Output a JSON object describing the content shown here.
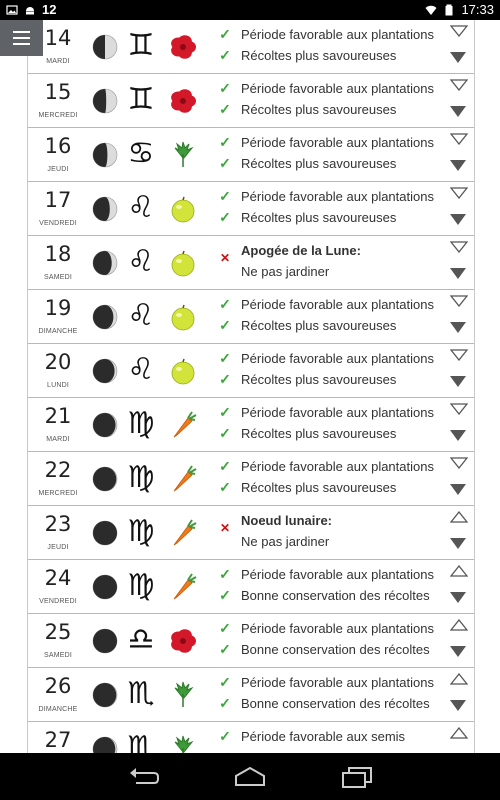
{
  "status_bar": {
    "time": "17:33",
    "notification_count": "12",
    "icons": [
      "image-icon",
      "android-icon",
      "wifi-icon",
      "battery-icon"
    ]
  },
  "colors": {
    "check": "#3aa63a",
    "cross": "#d01010",
    "menu_bg": "#5f6368"
  },
  "rows": [
    {
      "day": "14",
      "weekday": "MARDI",
      "moon": 0.5,
      "zodiac": "♊",
      "plant": "flower",
      "mark1": "check",
      "line1": "Période favorable aux plantations",
      "bold1": false,
      "mark2": "check",
      "line2": "Récoltes plus savoureuses",
      "arrow": "down"
    },
    {
      "day": "15",
      "weekday": "MERCREDI",
      "moon": 0.55,
      "zodiac": "♊",
      "plant": "flower",
      "mark1": "check",
      "line1": "Période favorable aux plantations",
      "bold1": false,
      "mark2": "check",
      "line2": "Récoltes plus savoureuses",
      "arrow": "down"
    },
    {
      "day": "16",
      "weekday": "JEUDI",
      "moon": 0.6,
      "zodiac": "♋",
      "plant": "leaf",
      "mark1": "check",
      "line1": "Période favorable aux plantations",
      "bold1": false,
      "mark2": "check",
      "line2": "Récoltes plus savoureuses",
      "arrow": "down"
    },
    {
      "day": "17",
      "weekday": "VENDREDI",
      "moon": 0.7,
      "zodiac": "♌",
      "plant": "fruit",
      "mark1": "check",
      "line1": "Période favorable aux plantations",
      "bold1": false,
      "mark2": "check",
      "line2": "Récoltes plus savoureuses",
      "arrow": "down"
    },
    {
      "day": "18",
      "weekday": "SAMEDI",
      "moon": 0.78,
      "zodiac": "♌",
      "plant": "fruit",
      "mark1": "cross",
      "line1": "Apogée de la Lune:",
      "bold1": true,
      "mark2": "",
      "line2": "Ne pas jardiner",
      "arrow": "down"
    },
    {
      "day": "19",
      "weekday": "DIMANCHE",
      "moon": 0.85,
      "zodiac": "♌",
      "plant": "fruit",
      "mark1": "check",
      "line1": "Période favorable aux plantations",
      "bold1": false,
      "mark2": "check",
      "line2": "Récoltes plus savoureuses",
      "arrow": "down"
    },
    {
      "day": "20",
      "weekday": "LUNDI",
      "moon": 0.9,
      "zodiac": "♌",
      "plant": "fruit",
      "mark1": "check",
      "line1": "Période favorable aux plantations",
      "bold1": false,
      "mark2": "check",
      "line2": "Récoltes plus savoureuses",
      "arrow": "down"
    },
    {
      "day": "21",
      "weekday": "MARDI",
      "moon": 0.94,
      "zodiac": "♍",
      "plant": "root",
      "mark1": "check",
      "line1": "Période favorable aux plantations",
      "bold1": false,
      "mark2": "check",
      "line2": "Récoltes plus savoureuses",
      "arrow": "down"
    },
    {
      "day": "22",
      "weekday": "MERCREDI",
      "moon": 0.97,
      "zodiac": "♍",
      "plant": "root",
      "mark1": "check",
      "line1": "Période favorable aux plantations",
      "bold1": false,
      "mark2": "check",
      "line2": "Récoltes plus savoureuses",
      "arrow": "down"
    },
    {
      "day": "23",
      "weekday": "JEUDI",
      "moon": 1.0,
      "zodiac": "♍",
      "plant": "root",
      "mark1": "cross",
      "line1": "Noeud lunaire:",
      "bold1": true,
      "mark2": "",
      "line2": "Ne pas jardiner",
      "arrow": "up"
    },
    {
      "day": "24",
      "weekday": "VENDREDI",
      "moon": 1.0,
      "zodiac": "♍",
      "plant": "root",
      "mark1": "check",
      "line1": "Période favorable aux plantations",
      "bold1": false,
      "mark2": "check",
      "line2": "Bonne conservation des récoltes",
      "arrow": "up"
    },
    {
      "day": "25",
      "weekday": "SAMEDI",
      "moon": 1.0,
      "zodiac": "♎",
      "plant": "flower",
      "mark1": "check",
      "line1": "Période favorable aux plantations",
      "bold1": false,
      "mark2": "check",
      "line2": "Bonne conservation des récoltes",
      "arrow": "up"
    },
    {
      "day": "26",
      "weekday": "DIMANCHE",
      "moon": 0.97,
      "zodiac": "♏",
      "plant": "leaf",
      "mark1": "check",
      "line1": "Période favorable aux plantations",
      "bold1": false,
      "mark2": "check",
      "line2": "Bonne conservation des récoltes",
      "arrow": "up"
    },
    {
      "day": "27",
      "weekday": "",
      "moon": 0.93,
      "zodiac": "♏",
      "plant": "leaf",
      "mark1": "check",
      "line1": "Période favorable aux semis",
      "bold1": false,
      "mark2": "check",
      "line2": "",
      "arrow": "up"
    }
  ],
  "nav_bar": {
    "buttons": [
      "back-icon",
      "home-icon",
      "recent-apps-icon"
    ]
  }
}
